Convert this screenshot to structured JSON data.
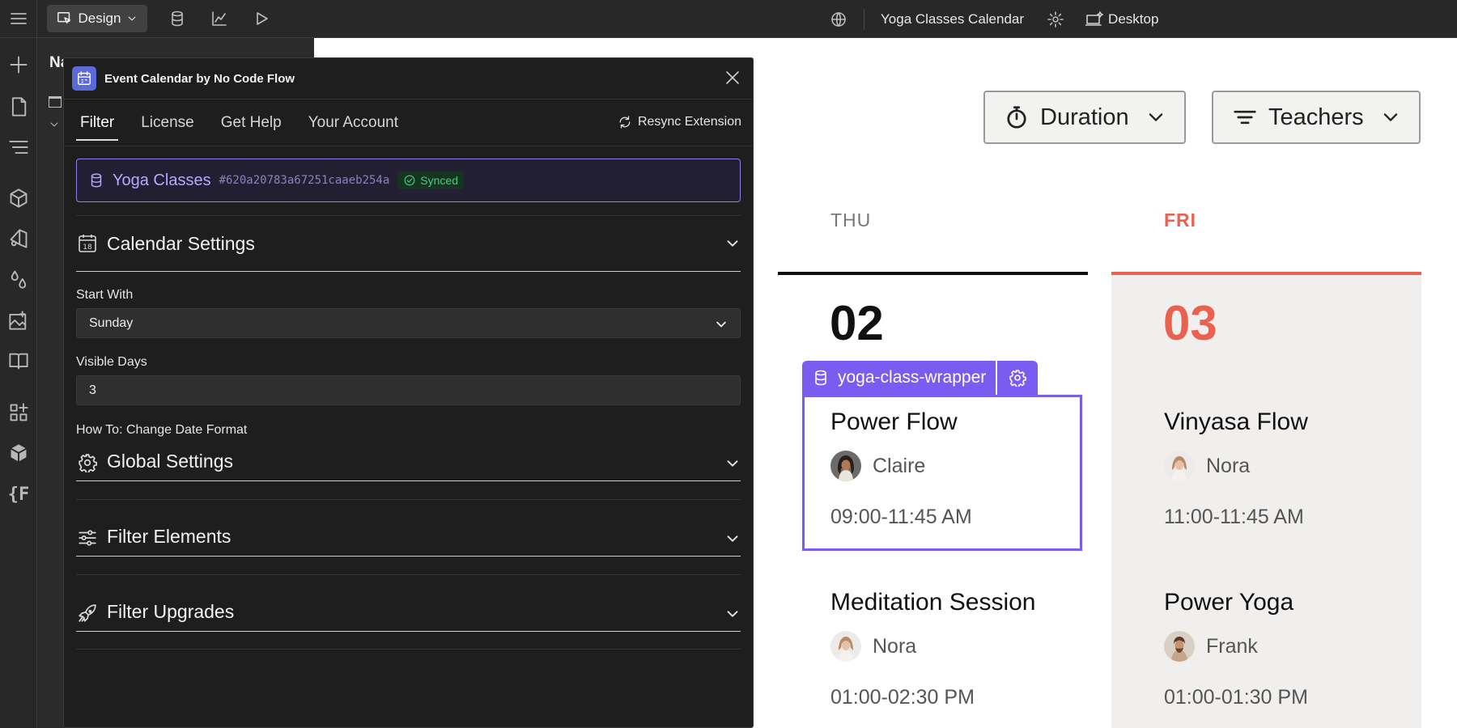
{
  "topbar": {
    "mode_label": "Design",
    "page_name": "Yoga Classes Calendar",
    "breakpoint_label": "Desktop"
  },
  "navigator": {
    "title": "Na"
  },
  "extension": {
    "title": "Event Calendar by No Code Flow",
    "tabs": [
      "Filter",
      "License",
      "Get Help",
      "Your Account"
    ],
    "active_tab": "Filter",
    "resync_label": "Resync Extension",
    "collection": {
      "name": "Yoga Classes",
      "id": "#620a20783a67251caaeb254a",
      "status": "Synced"
    },
    "calendar_settings": {
      "title": "Calendar Settings",
      "start_with_label": "Start With",
      "start_with_value": "Sunday",
      "visible_days_label": "Visible Days",
      "visible_days_value": "3",
      "howto_link": "How To: Change Date Format"
    },
    "sections": [
      "Global Settings",
      "Filter Elements",
      "Filter Upgrades"
    ]
  },
  "canvas": {
    "filters": {
      "duration_label": "Duration",
      "teachers_label": "Teachers"
    },
    "accent_color": "#e8624f",
    "selection_color": "#7a5cf0",
    "days": [
      {
        "name": "THU",
        "number": "02",
        "events": [
          {
            "title": "Power Flow",
            "teacher": "Claire",
            "time": "09:00-11:45 AM"
          },
          {
            "title": "Meditation Session",
            "teacher": "Nora",
            "time": "01:00-02:30 PM"
          }
        ]
      },
      {
        "name": "FRI",
        "number": "03",
        "events": [
          {
            "title": "Vinyasa Flow",
            "teacher": "Nora",
            "time": "11:00-11:45 AM"
          },
          {
            "title": "Power Yoga",
            "teacher": "Frank",
            "time": "01:00-01:30 PM"
          }
        ]
      }
    ],
    "selected_element_label": "yoga-class-wrapper"
  }
}
